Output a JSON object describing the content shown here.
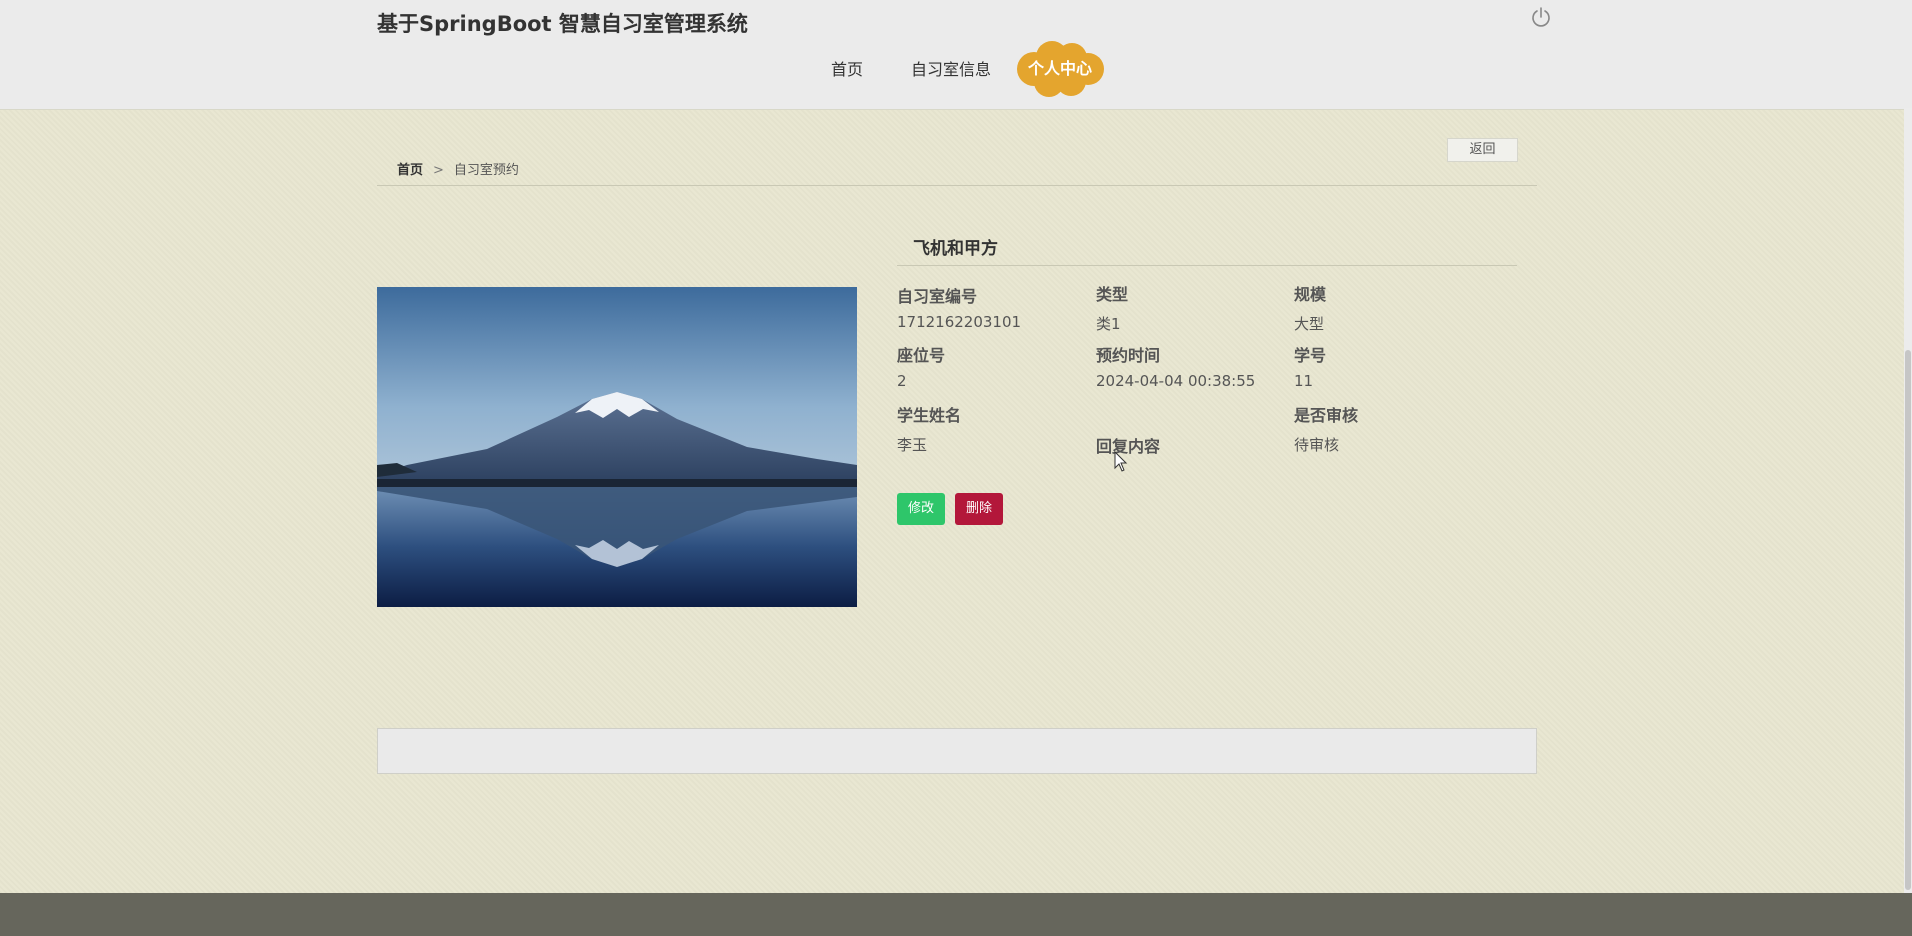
{
  "header": {
    "site_title": "基于SpringBoot 智慧自习室管理系统",
    "nav": [
      {
        "label": "首页"
      },
      {
        "label": "自习室信息"
      },
      {
        "label": "个人中心",
        "active": true
      }
    ],
    "logout_icon": "power-icon",
    "active_nav_color": "#e4a52e"
  },
  "back_button": {
    "label": "返回"
  },
  "breadcrumb": {
    "home": "首页",
    "separator": ">",
    "current": "自习室预约"
  },
  "detail": {
    "title": "飞机和甲方",
    "image": "mountain-lake-photo",
    "fields": {
      "room_no": {
        "label": "自习室编号",
        "value": "1712162203101"
      },
      "type": {
        "label": "类型",
        "value": "类1"
      },
      "scale": {
        "label": "规模",
        "value": "大型"
      },
      "seat_no": {
        "label": "座位号",
        "value": "2"
      },
      "reserve_time": {
        "label": "预约时间",
        "value": "2024-04-04 00:38:55"
      },
      "student_no": {
        "label": "学号",
        "value": "11"
      },
      "student_name": {
        "label": "学生姓名",
        "value": "李玉"
      },
      "reply": {
        "label": "回复内容",
        "value": ""
      },
      "review": {
        "label": "是否审核",
        "value": "待审核"
      }
    },
    "edit_label": "修改",
    "delete_label": "删除"
  },
  "colors": {
    "edit": "#2ec66a",
    "delete": "#b3173a",
    "footer": "#66665c",
    "page_bg": "#e8e6d0"
  }
}
